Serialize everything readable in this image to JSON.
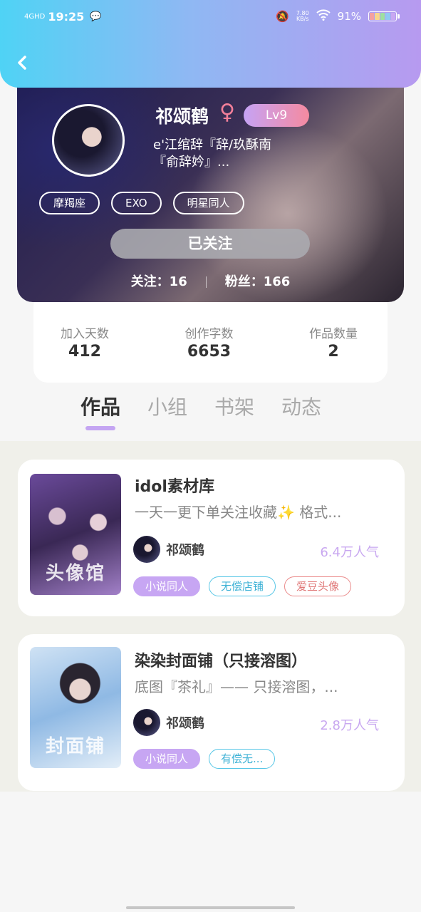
{
  "status_bar": {
    "network": "4GHD",
    "time": "19:25",
    "speed_value": "7.80",
    "speed_unit": "KB/s",
    "battery": "91%"
  },
  "profile": {
    "name": "祁颂鹤",
    "gender_symbol": "♀",
    "level": "Lv9",
    "signature": "e'江绾辞『辞/玖酥南『俞辞妗』...",
    "tags": [
      "摩羯座",
      "EXO",
      "明星同人"
    ],
    "follow_button": "已关注",
    "following": "关注：16",
    "fans": "粉丝：166"
  },
  "stats": [
    {
      "label": "加入天数",
      "value": "412"
    },
    {
      "label": "创作字数",
      "value": "6653"
    },
    {
      "label": "作品数量",
      "value": "2"
    }
  ],
  "tabs": [
    "作品",
    "小组",
    "书架",
    "动态"
  ],
  "works": [
    {
      "title": "idol素材库",
      "desc": "一天一更下单关注收藏✨ 格式...",
      "author": "祁颂鹤",
      "popularity": "6.4万人气",
      "cover_text": "头像馆",
      "tags": [
        {
          "label": "小说同人",
          "style": "purple"
        },
        {
          "label": "无偿店铺",
          "style": "cyan"
        },
        {
          "label": "爱豆头像",
          "style": "red"
        }
      ]
    },
    {
      "title": "染染封面铺（只接溶图）",
      "desc": "底图『茶礼』—— 只接溶图，...",
      "author": "祁颂鹤",
      "popularity": "2.8万人气",
      "cover_text": "封面铺",
      "tags": [
        {
          "label": "小说同人",
          "style": "purple"
        },
        {
          "label": "有偿无...",
          "style": "cyan"
        }
      ]
    }
  ],
  "colors": {
    "header_gradient": [
      "#4fd3f5",
      "#b79af0"
    ],
    "accent_purple": "#c7a6f3",
    "popularity": "#c8a7f0"
  }
}
